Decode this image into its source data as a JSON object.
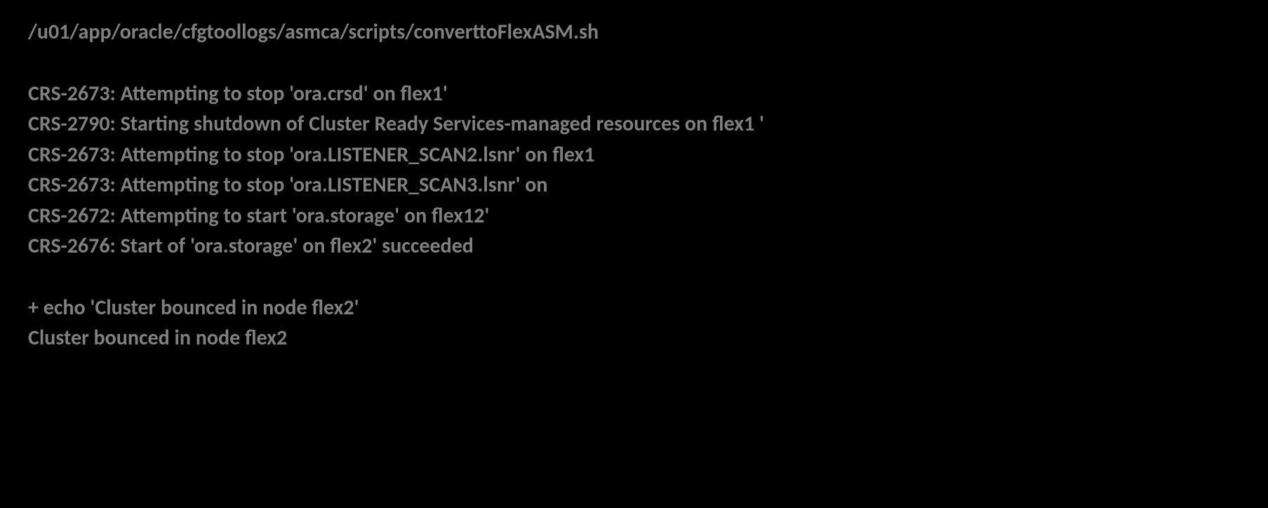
{
  "terminal": {
    "script_path": "/u01/app/oracle/cfgtoollogs/asmca/scripts/converttoFlexASM.sh",
    "lines": [
      "CRS-2673: Attempting to stop 'ora.crsd' on flex1'",
      "CRS-2790: Starting shutdown of Cluster Ready Services-managed resources on flex1 '",
      "CRS-2673: Attempting to stop 'ora.LISTENER_SCAN2.lsnr' on flex1",
      "CRS-2673: Attempting to stop 'ora.LISTENER_SCAN3.lsnr' on",
      "CRS-2672: Attempting to start 'ora.storage' on flex12'",
      "CRS-2676: Start of 'ora.storage' on flex2' succeeded"
    ],
    "echo_lines": [
      "+ echo 'Cluster bounced in node flex2'",
      "Cluster bounced in node flex2"
    ]
  }
}
